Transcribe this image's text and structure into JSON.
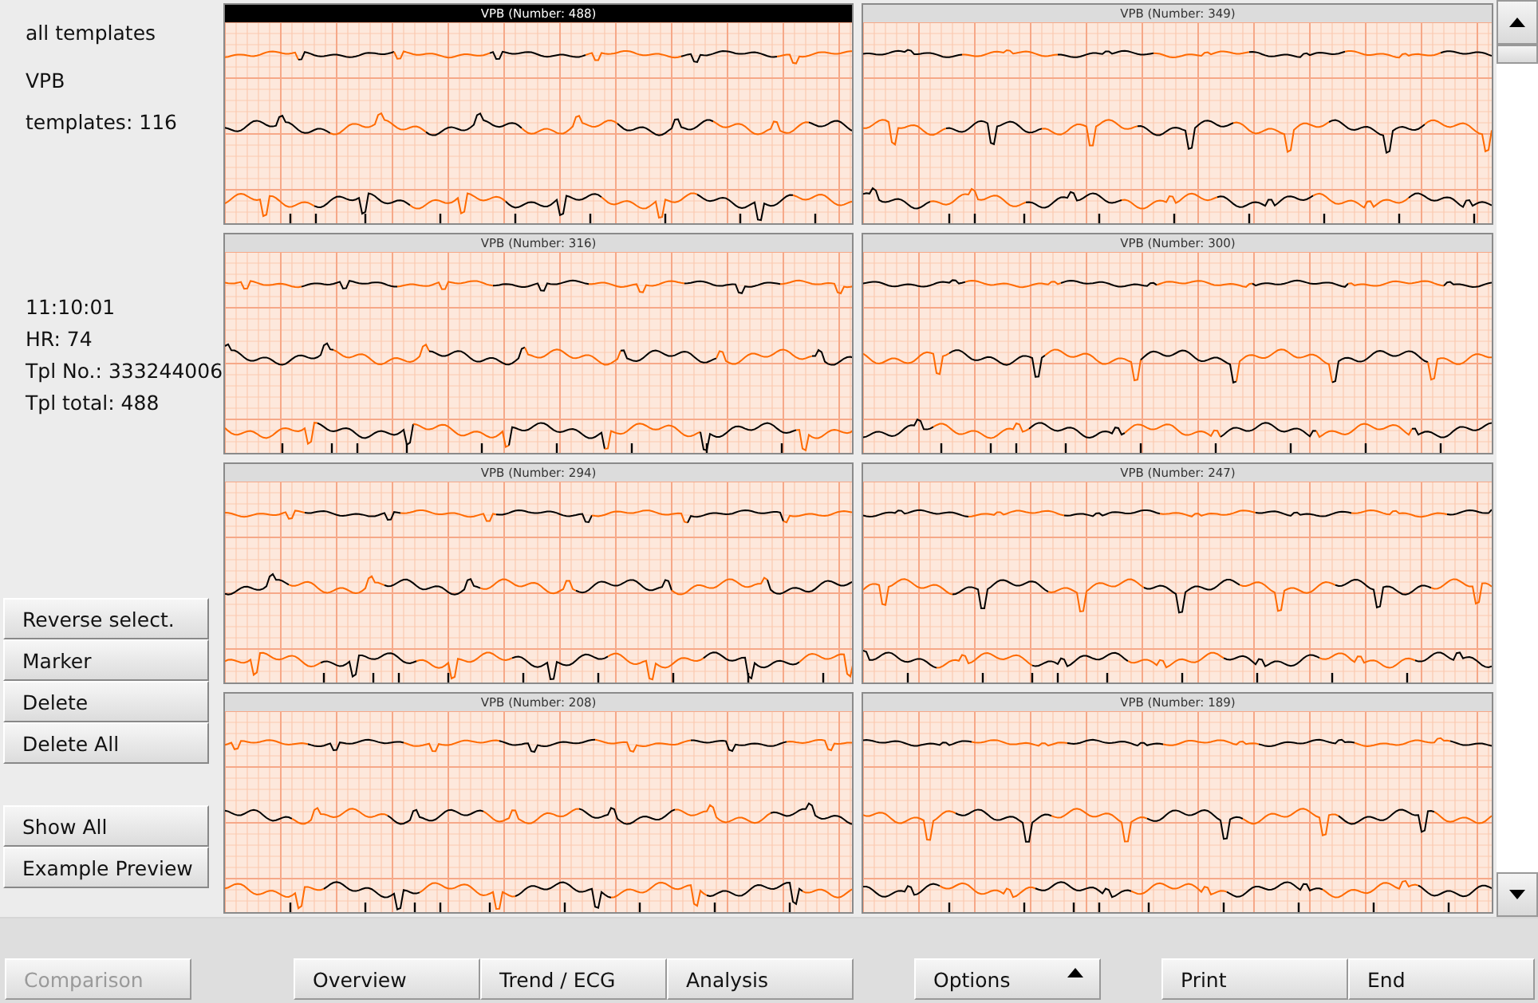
{
  "sidebar": {
    "filter": "all templates",
    "type": "VPB",
    "templates": "templates: 116",
    "details": [
      "11:10:01",
      "HR: 74",
      "Tpl No.: 333244006",
      "Tpl total: 488"
    ],
    "buttons_top": [
      "Reverse select.",
      "Marker",
      "Delete",
      "Delete All"
    ],
    "buttons_bottom": [
      "Show All",
      "Example Preview"
    ]
  },
  "templates": [
    {
      "title": "VPB (Number: 488)",
      "selected": true
    },
    {
      "title": "VPB (Number: 349)",
      "selected": false
    },
    {
      "title": "VPB (Number: 316)",
      "selected": false
    },
    {
      "title": "VPB (Number: 300)",
      "selected": false
    },
    {
      "title": "VPB (Number: 294)",
      "selected": false
    },
    {
      "title": "VPB (Number: 247)",
      "selected": false
    },
    {
      "title": "VPB (Number: 208)",
      "selected": false
    },
    {
      "title": "VPB (Number: 189)",
      "selected": false
    }
  ],
  "toolbar": [
    {
      "buttons": [
        {
          "label": "Comparison",
          "disabled": true
        }
      ]
    },
    {
      "buttons": [
        {
          "label": "Overview",
          "disabled": false
        },
        {
          "label": "Trend / ECG",
          "disabled": false
        },
        {
          "label": "Analysis",
          "disabled": false
        }
      ]
    },
    {
      "buttons": [
        {
          "label": "Options",
          "disabled": false,
          "menu": true
        }
      ]
    },
    {
      "buttons": [
        {
          "label": "Print",
          "disabled": false
        },
        {
          "label": "End",
          "disabled": false
        }
      ]
    }
  ]
}
